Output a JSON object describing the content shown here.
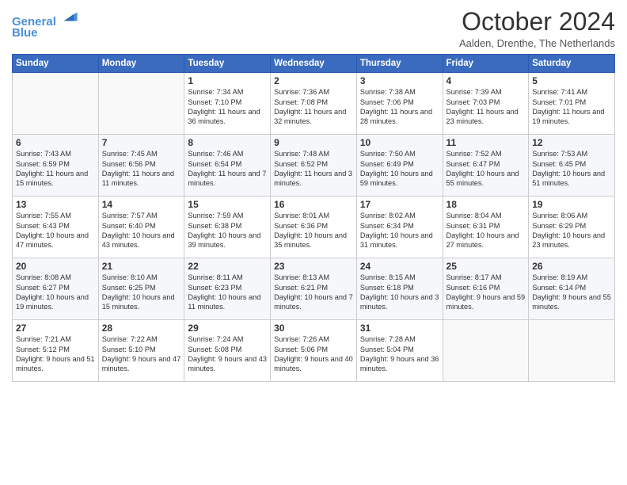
{
  "logo": {
    "line1": "General",
    "line2": "Blue"
  },
  "header": {
    "month": "October 2024",
    "location": "Aalden, Drenthe, The Netherlands"
  },
  "days_of_week": [
    "Sunday",
    "Monday",
    "Tuesday",
    "Wednesday",
    "Thursday",
    "Friday",
    "Saturday"
  ],
  "weeks": [
    [
      {
        "day": "",
        "content": ""
      },
      {
        "day": "",
        "content": ""
      },
      {
        "day": "1",
        "content": "Sunrise: 7:34 AM\nSunset: 7:10 PM\nDaylight: 11 hours and 36 minutes."
      },
      {
        "day": "2",
        "content": "Sunrise: 7:36 AM\nSunset: 7:08 PM\nDaylight: 11 hours and 32 minutes."
      },
      {
        "day": "3",
        "content": "Sunrise: 7:38 AM\nSunset: 7:06 PM\nDaylight: 11 hours and 28 minutes."
      },
      {
        "day": "4",
        "content": "Sunrise: 7:39 AM\nSunset: 7:03 PM\nDaylight: 11 hours and 23 minutes."
      },
      {
        "day": "5",
        "content": "Sunrise: 7:41 AM\nSunset: 7:01 PM\nDaylight: 11 hours and 19 minutes."
      }
    ],
    [
      {
        "day": "6",
        "content": "Sunrise: 7:43 AM\nSunset: 6:59 PM\nDaylight: 11 hours and 15 minutes."
      },
      {
        "day": "7",
        "content": "Sunrise: 7:45 AM\nSunset: 6:56 PM\nDaylight: 11 hours and 11 minutes."
      },
      {
        "day": "8",
        "content": "Sunrise: 7:46 AM\nSunset: 6:54 PM\nDaylight: 11 hours and 7 minutes."
      },
      {
        "day": "9",
        "content": "Sunrise: 7:48 AM\nSunset: 6:52 PM\nDaylight: 11 hours and 3 minutes."
      },
      {
        "day": "10",
        "content": "Sunrise: 7:50 AM\nSunset: 6:49 PM\nDaylight: 10 hours and 59 minutes."
      },
      {
        "day": "11",
        "content": "Sunrise: 7:52 AM\nSunset: 6:47 PM\nDaylight: 10 hours and 55 minutes."
      },
      {
        "day": "12",
        "content": "Sunrise: 7:53 AM\nSunset: 6:45 PM\nDaylight: 10 hours and 51 minutes."
      }
    ],
    [
      {
        "day": "13",
        "content": "Sunrise: 7:55 AM\nSunset: 6:43 PM\nDaylight: 10 hours and 47 minutes."
      },
      {
        "day": "14",
        "content": "Sunrise: 7:57 AM\nSunset: 6:40 PM\nDaylight: 10 hours and 43 minutes."
      },
      {
        "day": "15",
        "content": "Sunrise: 7:59 AM\nSunset: 6:38 PM\nDaylight: 10 hours and 39 minutes."
      },
      {
        "day": "16",
        "content": "Sunrise: 8:01 AM\nSunset: 6:36 PM\nDaylight: 10 hours and 35 minutes."
      },
      {
        "day": "17",
        "content": "Sunrise: 8:02 AM\nSunset: 6:34 PM\nDaylight: 10 hours and 31 minutes."
      },
      {
        "day": "18",
        "content": "Sunrise: 8:04 AM\nSunset: 6:31 PM\nDaylight: 10 hours and 27 minutes."
      },
      {
        "day": "19",
        "content": "Sunrise: 8:06 AM\nSunset: 6:29 PM\nDaylight: 10 hours and 23 minutes."
      }
    ],
    [
      {
        "day": "20",
        "content": "Sunrise: 8:08 AM\nSunset: 6:27 PM\nDaylight: 10 hours and 19 minutes."
      },
      {
        "day": "21",
        "content": "Sunrise: 8:10 AM\nSunset: 6:25 PM\nDaylight: 10 hours and 15 minutes."
      },
      {
        "day": "22",
        "content": "Sunrise: 8:11 AM\nSunset: 6:23 PM\nDaylight: 10 hours and 11 minutes."
      },
      {
        "day": "23",
        "content": "Sunrise: 8:13 AM\nSunset: 6:21 PM\nDaylight: 10 hours and 7 minutes."
      },
      {
        "day": "24",
        "content": "Sunrise: 8:15 AM\nSunset: 6:18 PM\nDaylight: 10 hours and 3 minutes."
      },
      {
        "day": "25",
        "content": "Sunrise: 8:17 AM\nSunset: 6:16 PM\nDaylight: 9 hours and 59 minutes."
      },
      {
        "day": "26",
        "content": "Sunrise: 8:19 AM\nSunset: 6:14 PM\nDaylight: 9 hours and 55 minutes."
      }
    ],
    [
      {
        "day": "27",
        "content": "Sunrise: 7:21 AM\nSunset: 5:12 PM\nDaylight: 9 hours and 51 minutes."
      },
      {
        "day": "28",
        "content": "Sunrise: 7:22 AM\nSunset: 5:10 PM\nDaylight: 9 hours and 47 minutes."
      },
      {
        "day": "29",
        "content": "Sunrise: 7:24 AM\nSunset: 5:08 PM\nDaylight: 9 hours and 43 minutes."
      },
      {
        "day": "30",
        "content": "Sunrise: 7:26 AM\nSunset: 5:06 PM\nDaylight: 9 hours and 40 minutes."
      },
      {
        "day": "31",
        "content": "Sunrise: 7:28 AM\nSunset: 5:04 PM\nDaylight: 9 hours and 36 minutes."
      },
      {
        "day": "",
        "content": ""
      },
      {
        "day": "",
        "content": ""
      }
    ]
  ]
}
